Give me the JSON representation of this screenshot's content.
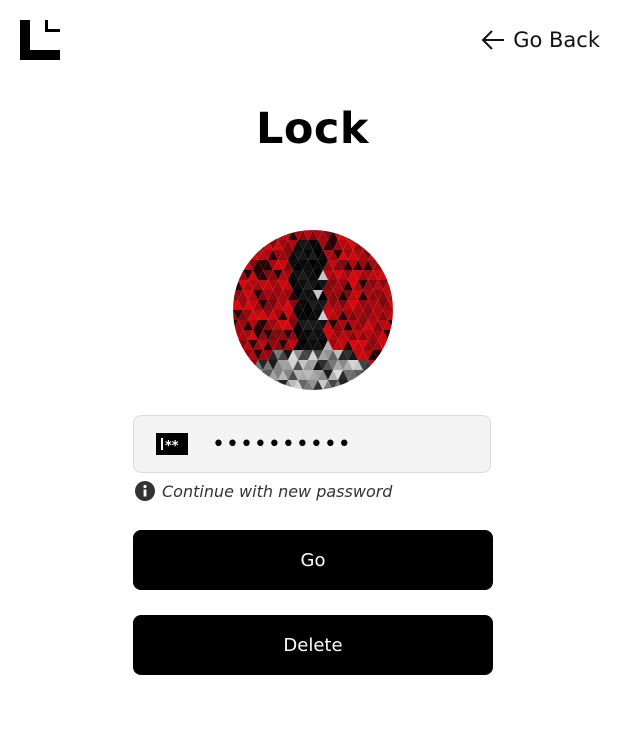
{
  "header": {
    "logo_icon": "brand-logo-corner-icon",
    "back_icon": "arrow-left-icon",
    "back_label": "Go Back"
  },
  "page": {
    "title": "Lock"
  },
  "avatar": {
    "icon": "user-avatar-mosaic"
  },
  "password": {
    "icon": "password-asterisks-icon",
    "value": "••••••••••",
    "hint_icon": "info-icon",
    "hint": "Continue with new password"
  },
  "actions": {
    "go_label": "Go",
    "delete_label": "Delete"
  },
  "colors": {
    "button_bg": "#000000",
    "button_text": "#ffffff",
    "field_bg": "#f4f4f4",
    "avatar_red": "#b5121b"
  }
}
